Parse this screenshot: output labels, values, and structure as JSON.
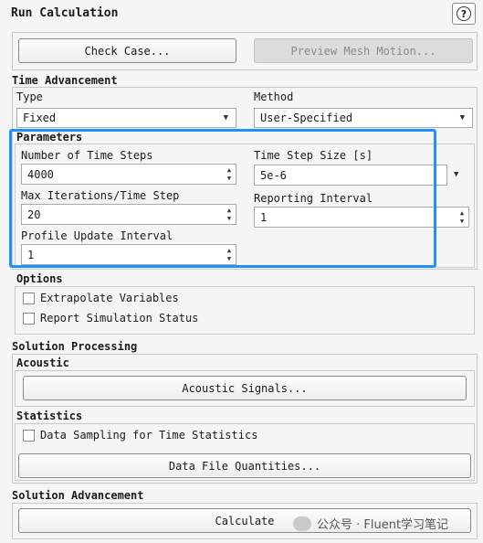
{
  "window": {
    "title": "Run Calculation"
  },
  "top_buttons": {
    "check_case": "Check Case...",
    "preview_mesh": "Preview Mesh Motion..."
  },
  "time_advancement": {
    "title": "Time Advancement",
    "type_label": "Type",
    "type_value": "Fixed",
    "method_label": "Method",
    "method_value": "User-Specified"
  },
  "parameters": {
    "title": "Parameters",
    "num_steps_label": "Number of Time Steps",
    "num_steps_value": "4000",
    "step_size_label": "Time Step Size [s]",
    "step_size_value": "5e-6",
    "max_iter_label": "Max Iterations/Time Step",
    "max_iter_value": "20",
    "report_label": "Reporting Interval",
    "report_value": "1",
    "profile_label": "Profile Update Interval",
    "profile_value": "1"
  },
  "options": {
    "title": "Options",
    "extrapolate": "Extrapolate Variables",
    "report_status": "Report Simulation Status"
  },
  "solution_processing": {
    "title": "Solution Processing",
    "acoustic_title": "Acoustic",
    "acoustic_button": "Acoustic Signals...",
    "statistics_title": "Statistics",
    "data_sampling": "Data Sampling for Time Statistics",
    "data_file_button": "Data File Quantities..."
  },
  "solution_advancement": {
    "title": "Solution Advancement",
    "calculate": "Calculate"
  },
  "watermark": {
    "text": "公众号 · Fluent学习笔记"
  },
  "icons": [
    "help-icon",
    "chevron-down-icon",
    "spinner-icon",
    "wechat-icon"
  ],
  "colors": {
    "highlight": "#1e90ff"
  }
}
